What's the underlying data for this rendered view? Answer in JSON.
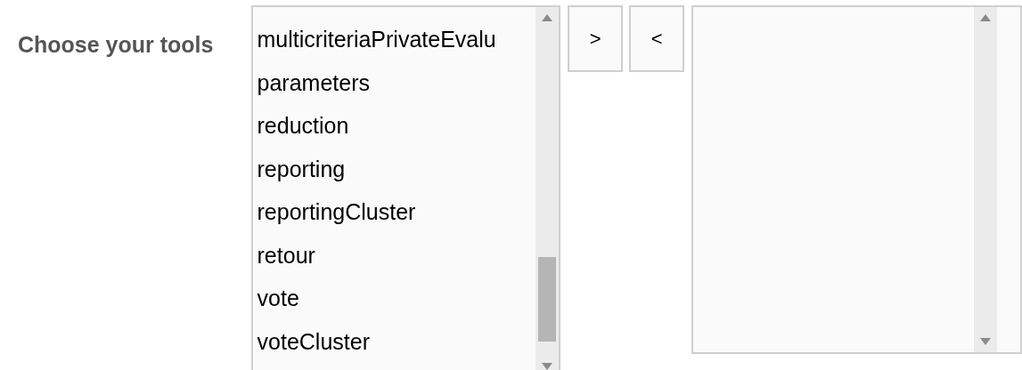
{
  "label": "Choose your tools",
  "available": {
    "items": [
      {
        "label": "multicriteriaPrivateEvalu"
      },
      {
        "label": "parameters"
      },
      {
        "label": "reduction"
      },
      {
        "label": "reporting"
      },
      {
        "label": "reportingCluster"
      },
      {
        "label": "retour"
      },
      {
        "label": "vote"
      },
      {
        "label": "voteCluster"
      }
    ]
  },
  "buttons": [
    {
      "label": ">"
    },
    {
      "label": "<"
    }
  ]
}
